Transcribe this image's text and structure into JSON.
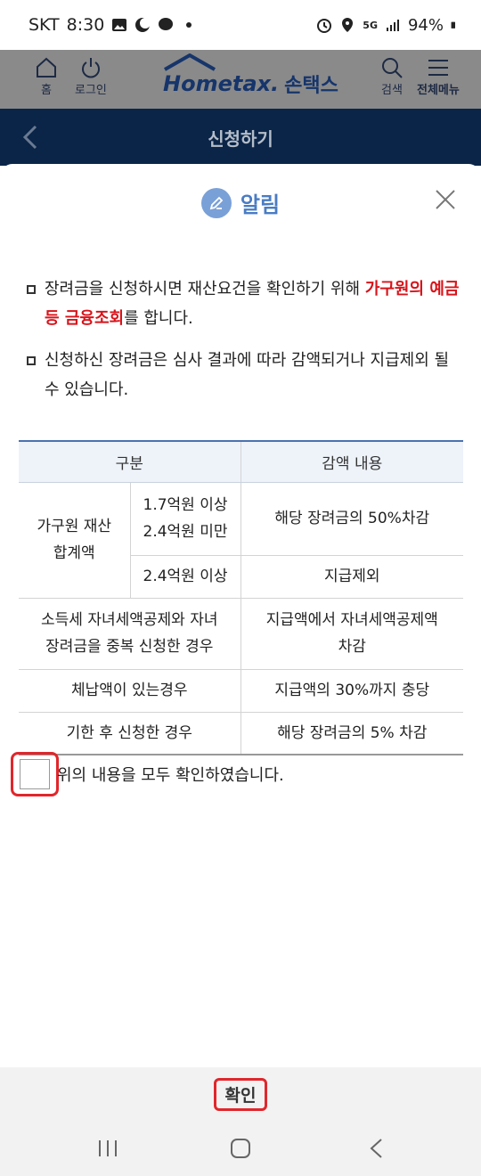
{
  "status_bar": {
    "carrier": "SKT",
    "time": "8:30",
    "battery": "94%",
    "network": "5G"
  },
  "header": {
    "home_label": "홈",
    "login_label": "로그인",
    "logo_text": "Hometax.",
    "logo_sub": "손택스",
    "search_label": "검색",
    "menu_label": "전체메뉴"
  },
  "page": {
    "title": "신청하기"
  },
  "modal": {
    "title": "알림",
    "notice1_pre": "장려금을 신청하시면 재산요건을 확인하기 위해 ",
    "notice1_hl": "가구원의 예금 등 금융조회",
    "notice1_post": "를 합니다.",
    "notice2": "신청하신 장려금은 심사 결과에 따라 감액되거나 지급제외 될 수 있습니다.",
    "table": {
      "headers": [
        "구분",
        "감액 내용"
      ],
      "row1_group": "가구원 재산 합계액",
      "row1a_cond_1": "1.7억원 이상",
      "row1a_cond_2": "2.4억원 미만",
      "row1a_result": "해당 장려금의 50%차감",
      "row1b_cond": "2.4억원 이상",
      "row1b_result": "지급제외",
      "row2_cond_1": "소득세 자녀세액공제와 자녀",
      "row2_cond_2": "장려금을 중복 신청한 경우",
      "row2_result_1": "지급액에서 자녀세액공제액",
      "row2_result_2": "차감",
      "row3_cond": "체납액이 있는경우",
      "row3_result": "지급액의 30%까지 충당",
      "row4_cond": "기한 후 신청한 경우",
      "row4_result": "해당 장려금의 5% 차감"
    },
    "confirm_text": "위의 내용을 모두 확인하였습니다.",
    "ok_label": "확인"
  },
  "colors": {
    "accent_red": "#d8141b",
    "navy": "#0a2548",
    "title_blue": "#4a7cc4"
  }
}
